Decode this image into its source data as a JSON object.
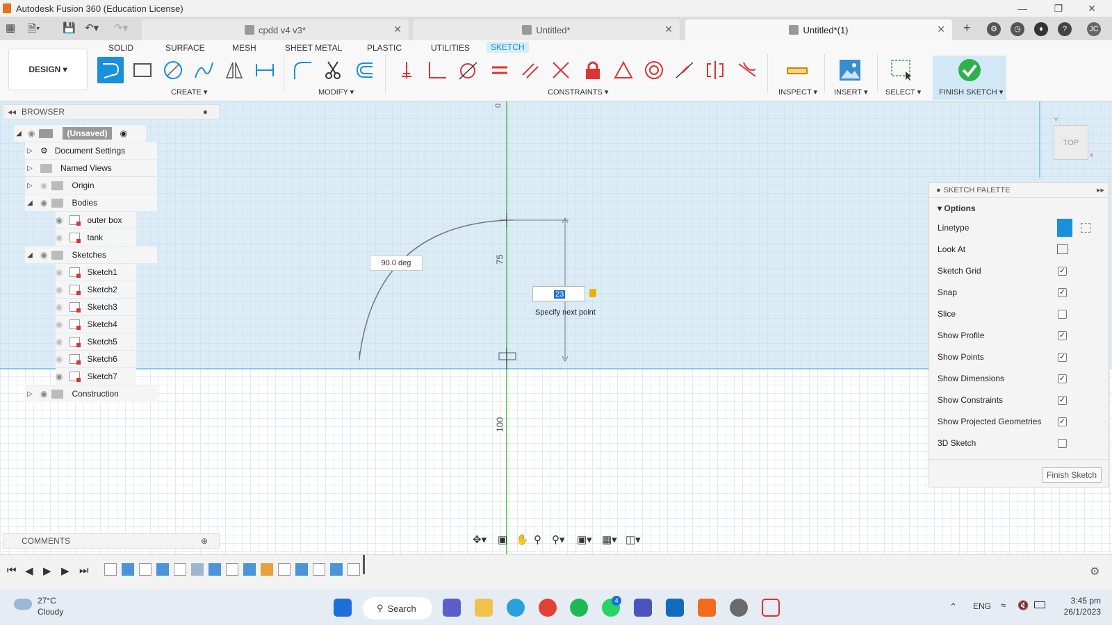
{
  "window": {
    "title": "Autodesk Fusion 360 (Education License)"
  },
  "doc_tabs": [
    "cpdd v4 v3*",
    "Untitled*",
    "Untitled*(1)"
  ],
  "user_initials": "JC",
  "workspace": "DESIGN",
  "ribbon_tabs": [
    "SOLID",
    "SURFACE",
    "MESH",
    "SHEET METAL",
    "PLASTIC",
    "UTILITIES",
    "SKETCH"
  ],
  "groups": {
    "create": "CREATE",
    "modify": "MODIFY",
    "constraints": "CONSTRAINTS",
    "inspect": "INSPECT",
    "insert": "INSERT",
    "select": "SELECT",
    "finish": "FINISH SKETCH"
  },
  "browser": {
    "title": "BROWSER",
    "root": "(Unsaved)",
    "items": [
      "Document Settings",
      "Named Views",
      "Origin",
      "Bodies",
      "outer box",
      "tank",
      "Sketches",
      "Sketch1",
      "Sketch2",
      "Sketch3",
      "Sketch4",
      "Sketch5",
      "Sketch6",
      "Sketch7",
      "Construction"
    ]
  },
  "comments": "COMMENTS",
  "viewcube": "TOP",
  "sketch": {
    "angle": "90.0 deg",
    "dim_75": "75",
    "dim_100": "100",
    "input": "23",
    "hint": "Specify next point"
  },
  "palette": {
    "title": "SKETCH PALETTE",
    "section": "Options",
    "rows": [
      "Linetype",
      "Look At",
      "Sketch Grid",
      "Snap",
      "Slice",
      "Show Profile",
      "Show Points",
      "Show Dimensions",
      "Show Constraints",
      "Show Projected Geometries",
      "3D Sketch"
    ],
    "checked": [
      true,
      true,
      false,
      true,
      true,
      true,
      true,
      true,
      false
    ],
    "finish": "Finish Sketch"
  },
  "weather": {
    "temp": "27°C",
    "cond": "Cloudy"
  },
  "taskbar": {
    "search": "Search",
    "lang": "ENG",
    "time": "3:45 pm",
    "date": "26/1/2023",
    "badge": "4"
  }
}
